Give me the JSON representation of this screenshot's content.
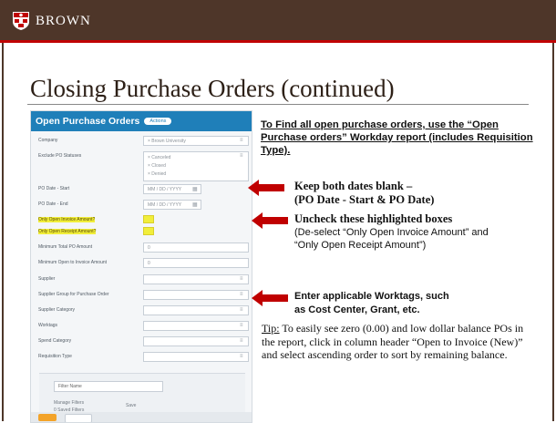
{
  "header": {
    "brand": "BROWN",
    "bar_color": "#4e3629",
    "accent_color": "#c00404"
  },
  "slide": {
    "title": "Closing Purchase Orders (continued)"
  },
  "panel": {
    "title": "Open Purchase Orders",
    "badge": "Actions",
    "header_color": "#1f7fb9",
    "highlight_color": "#f1ee3a",
    "fields": [
      {
        "label": "Company",
        "value": "× Brown University"
      },
      {
        "label": "Exclude PO Statuses",
        "values": [
          "× Canceled",
          "× Closed",
          "× Denied"
        ]
      },
      {
        "label": "PO Date - Start",
        "placeholder": "MM / DD / YYYY"
      },
      {
        "label": "PO Date - End",
        "placeholder": "MM / DD / YYYY"
      },
      {
        "label": "Only Open Invoice Amount?"
      },
      {
        "label": "Only Open Receipt Amount?"
      },
      {
        "label": "Minimum Total PO Amount",
        "value": "0"
      },
      {
        "label": "Minimum Open to Invoice Amount",
        "value": "0"
      },
      {
        "label": "Supplier"
      },
      {
        "label": "Supplier Group for Purchase Order"
      },
      {
        "label": "Supplier Category"
      },
      {
        "label": "Worktags"
      },
      {
        "label": "Spend Category"
      },
      {
        "label": "Requisition Type"
      }
    ],
    "filter": {
      "name_placeholder": "Filter Name",
      "manage_label": "Manage Filters",
      "saved_label": "0 Saved Filters",
      "save_button": "Save"
    },
    "ok_label": "OK",
    "cancel_label": "Cancel"
  },
  "notes": {
    "main": "To Find all open purchase orders, use the “Open Purchase orders” Workday report (includes Requisition Type).",
    "dates_line1": "Keep both dates blank –",
    "dates_line2": "(PO Date - Start & PO Date)",
    "uncheck_bold": "Uncheck these highlighted boxes",
    "uncheck_detail": "(De-select “Only Open Invoice Amount” and “Only Open Receipt Amount”)",
    "worktags_line1": "Enter applicable Worktags, such",
    "worktags_line2": "as Cost Center, Grant, etc.",
    "tip_label": "Tip:",
    "tip_text": " To easily see zero (0.00) and low dollar balance POs in the report, click in column header “Open to Invoice (New)” and select ascending order to sort by remaining balance.",
    "arrow_color": "#c00000"
  }
}
